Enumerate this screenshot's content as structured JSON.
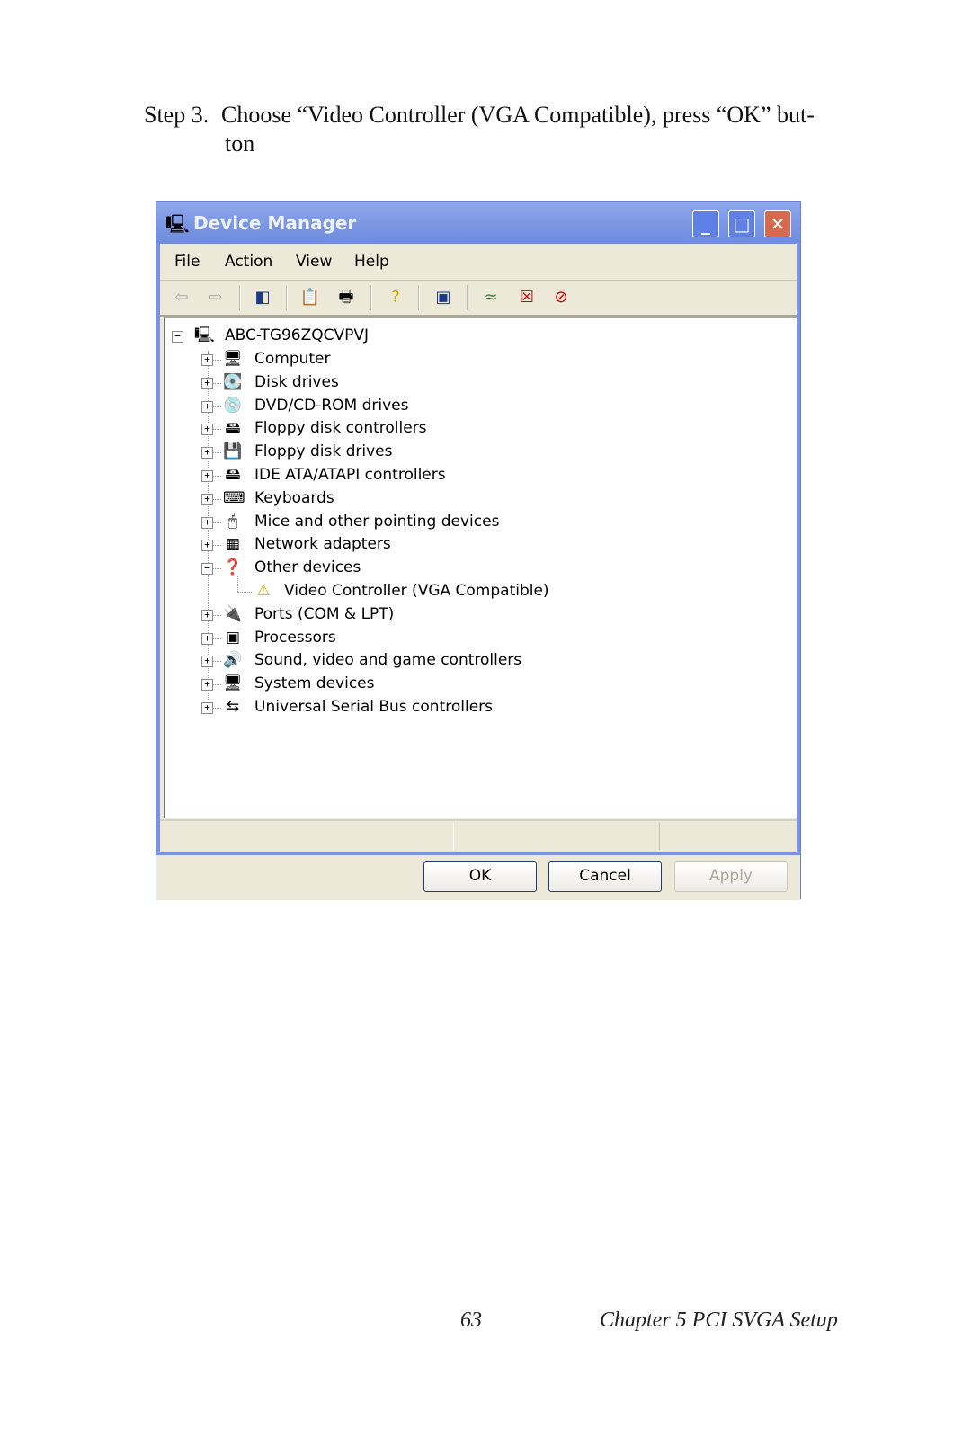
{
  "instruction": {
    "step": "Step 3.",
    "text": "Choose “Video Controller (VGA Compatible), press “OK” but-",
    "continuation": "ton"
  },
  "window": {
    "title": "Device Manager",
    "controls": {
      "minimize": "_",
      "maximize": "□",
      "close": "✕"
    }
  },
  "menu": [
    "File",
    "Action",
    "View",
    "Help"
  ],
  "toolbar": [
    "back-icon",
    "forward-icon",
    "show-hide-tree-icon",
    "properties-icon",
    "print-icon",
    "help-icon",
    "scan-hardware-icon",
    "update-driver-icon",
    "uninstall-icon",
    "disable-icon"
  ],
  "tree": {
    "root": "ABC-TG96ZQCVPVJ",
    "items": [
      {
        "label": "Computer",
        "icon": "🖥"
      },
      {
        "label": "Disk drives",
        "icon": "💽"
      },
      {
        "label": "DVD/CD-ROM drives",
        "icon": "💿"
      },
      {
        "label": "Floppy disk controllers",
        "icon": "🖴"
      },
      {
        "label": "Floppy disk drives",
        "icon": "💾"
      },
      {
        "label": "IDE ATA/ATAPI controllers",
        "icon": "🖴"
      },
      {
        "label": "Keyboards",
        "icon": "⌨"
      },
      {
        "label": "Mice and other pointing devices",
        "icon": "🖱"
      },
      {
        "label": "Network adapters",
        "icon": "▦"
      },
      {
        "label": "Other devices",
        "icon": "❓",
        "expanded": true
      },
      {
        "label": "Video Controller (VGA Compatible)",
        "icon": "⚠",
        "child": true
      },
      {
        "label": "Ports (COM & LPT)",
        "icon": "🔌"
      },
      {
        "label": "Processors",
        "icon": "▣"
      },
      {
        "label": "Sound, video and game controllers",
        "icon": "🔊"
      },
      {
        "label": "System devices",
        "icon": "🖥"
      },
      {
        "label": "Universal Serial Bus controllers",
        "icon": "⇆"
      }
    ]
  },
  "buttons": {
    "ok": "OK",
    "cancel": "Cancel",
    "apply": "Apply"
  },
  "footer": {
    "page": "63",
    "chapter": "Chapter 5  PCI SVGA Setup"
  }
}
